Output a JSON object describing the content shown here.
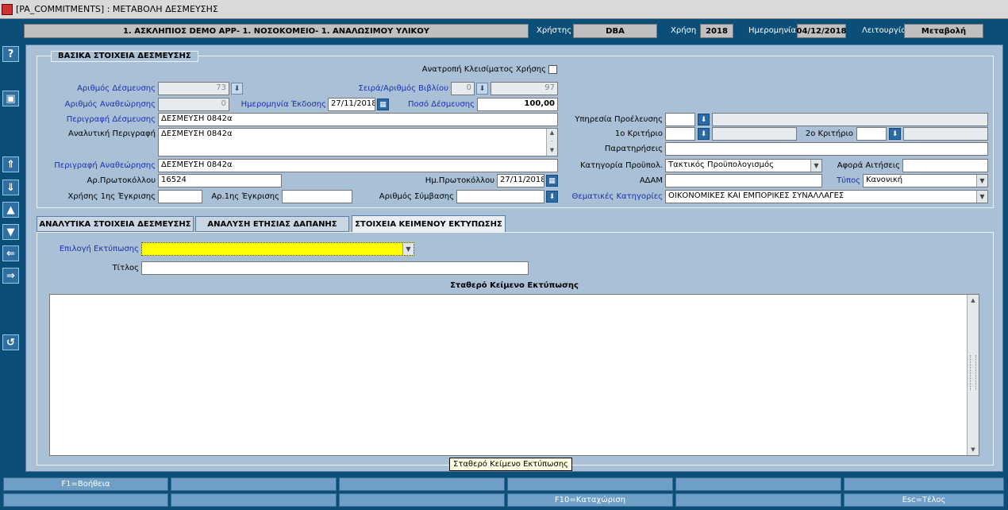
{
  "window": {
    "title": "[PA_COMMITMENTS]  :  ΜΕΤΑΒΟΛΗ ΔΕΣΜΕΥΣΗΣ"
  },
  "header": {
    "org": "1. ΑΣΚΛΗΠΙΟΣ DEMO APP- 1. ΝΟΣΟΚΟΜΕΙΟ- 1. ΑΝΑΛΩΣΙΜΟΥ ΥΛΙΚΟΥ",
    "user_label": "Χρήστης",
    "user": "DBA",
    "year_label": "Χρήση",
    "year": "2018",
    "date_label": "Ημερομηνία",
    "date": "04/12/2018",
    "mode_label": "Λειτουργία",
    "mode": "Μεταβολή"
  },
  "side_icons": [
    "help-icon",
    "save-icon",
    "first-record-icon",
    "next-record-icon",
    "prev-block-icon",
    "next-block-icon",
    "prev-icon",
    "next-icon",
    "undo-icon"
  ],
  "basic": {
    "section_title": "ΒΑΣΙΚΑ ΣΤΟΙΧΕΙΑ ΔΕΣΜΕΥΣΗΣ",
    "reverse_close_label": "Ανατροπή Κλεισίματος Χρήσης",
    "commit_no_label": "Αριθμός Δέσμευσης",
    "commit_no": "73",
    "series_label": "Σειρά/Αριθμός Βιβλίου",
    "series": "0",
    "book_no": "97",
    "revision_label": "Αριθμός Αναθεώρησης",
    "revision": "0",
    "issue_date_label": "Ημερομηνία Έκδοσης",
    "issue_date": "27/11/2018",
    "amount_label": "Ποσό Δέσμευσης",
    "amount": "100,00",
    "desc_label": "Περιγραφή Δέσμευσης",
    "desc": "ΔΕΣΜΕΥΣΗ 0842α",
    "detail_desc_label": "Αναλυτική Περιγραφή",
    "detail_desc": "ΔΕΣΜΕΥΣΗ 0842α",
    "rev_desc_label": "Περιγραφή Αναθεώρησης",
    "rev_desc": "ΔΕΣΜΕΥΣΗ 0842α",
    "protocol_label": "Αρ.Πρωτοκόλλου",
    "protocol": "16524",
    "protocol_date_label": "Ημ.Πρωτοκόλλου",
    "protocol_date": "27/11/2018",
    "first_approval_year_label": "Χρήσης 1ης Έγκρισης",
    "first_approval_year": "",
    "first_approval_no_label": "Αρ.1ης Έγκρισης",
    "first_approval_no": "",
    "contract_label": "Αριθμός Σύμβασης",
    "contract": "",
    "origin_service_label": "Υπηρεσία Προέλευσης",
    "origin_service": "",
    "crit1_label": "1ο Κριτήριο",
    "crit1": "",
    "crit2_label": "2ο Κριτήριο",
    "crit2": "",
    "notes_label": "Παρατηρήσεις",
    "notes": "",
    "budget_cat_label": "Κατηγορία Προϋπολ.",
    "budget_cat": "Τακτικός Προϋπολογισμός",
    "requests_label": "Αφορά Αιτήσεις",
    "requests": "",
    "adam_label": "ΑΔΑΜ",
    "adam": "",
    "type_label": "Τύπος",
    "type": "Κανονική",
    "thematic_label": "Θεματικές Κατηγορίες",
    "thematic": "ΟΙΚΟΝΟΜΙΚΕΣ ΚΑΙ ΕΜΠΟΡΙΚΕΣ ΣΥΝΑΛΛΑΓΕΣ"
  },
  "tabs": [
    {
      "label": "ΑΝΑΛΥΤΙΚΑ ΣΤΟΙΧΕΙΑ ΔΕΣΜΕΥΣΗΣ"
    },
    {
      "label": "ΑΝΑΛΥΣΗ ΕΤΗΣΙΑΣ ΔΑΠΑΝΗΣ"
    },
    {
      "label": "ΣΤΟΙΧΕΙΑ ΚΕΙΜΕΝΟΥ ΕΚΤΥΠΩΣΗΣ"
    }
  ],
  "print": {
    "choice_label": "Επιλογή Εκτύπωσης",
    "choice": "",
    "title_label": "Τίτλος",
    "title": "",
    "fixed_text_label": "Σταθερό Κείμενο Εκτύπωσης",
    "tooltip": "Σταθερό Κείμενο Εκτύπωσης"
  },
  "fkeys": {
    "f1": "F1=Βοήθεια",
    "f10": "F10=Καταχώριση",
    "esc": "Esc=Τέλος"
  },
  "colors": {
    "background": "#0b4f78",
    "panel": "#a9c0d6",
    "required_label": "#1c2fb0",
    "highlight": "#ffff00"
  }
}
